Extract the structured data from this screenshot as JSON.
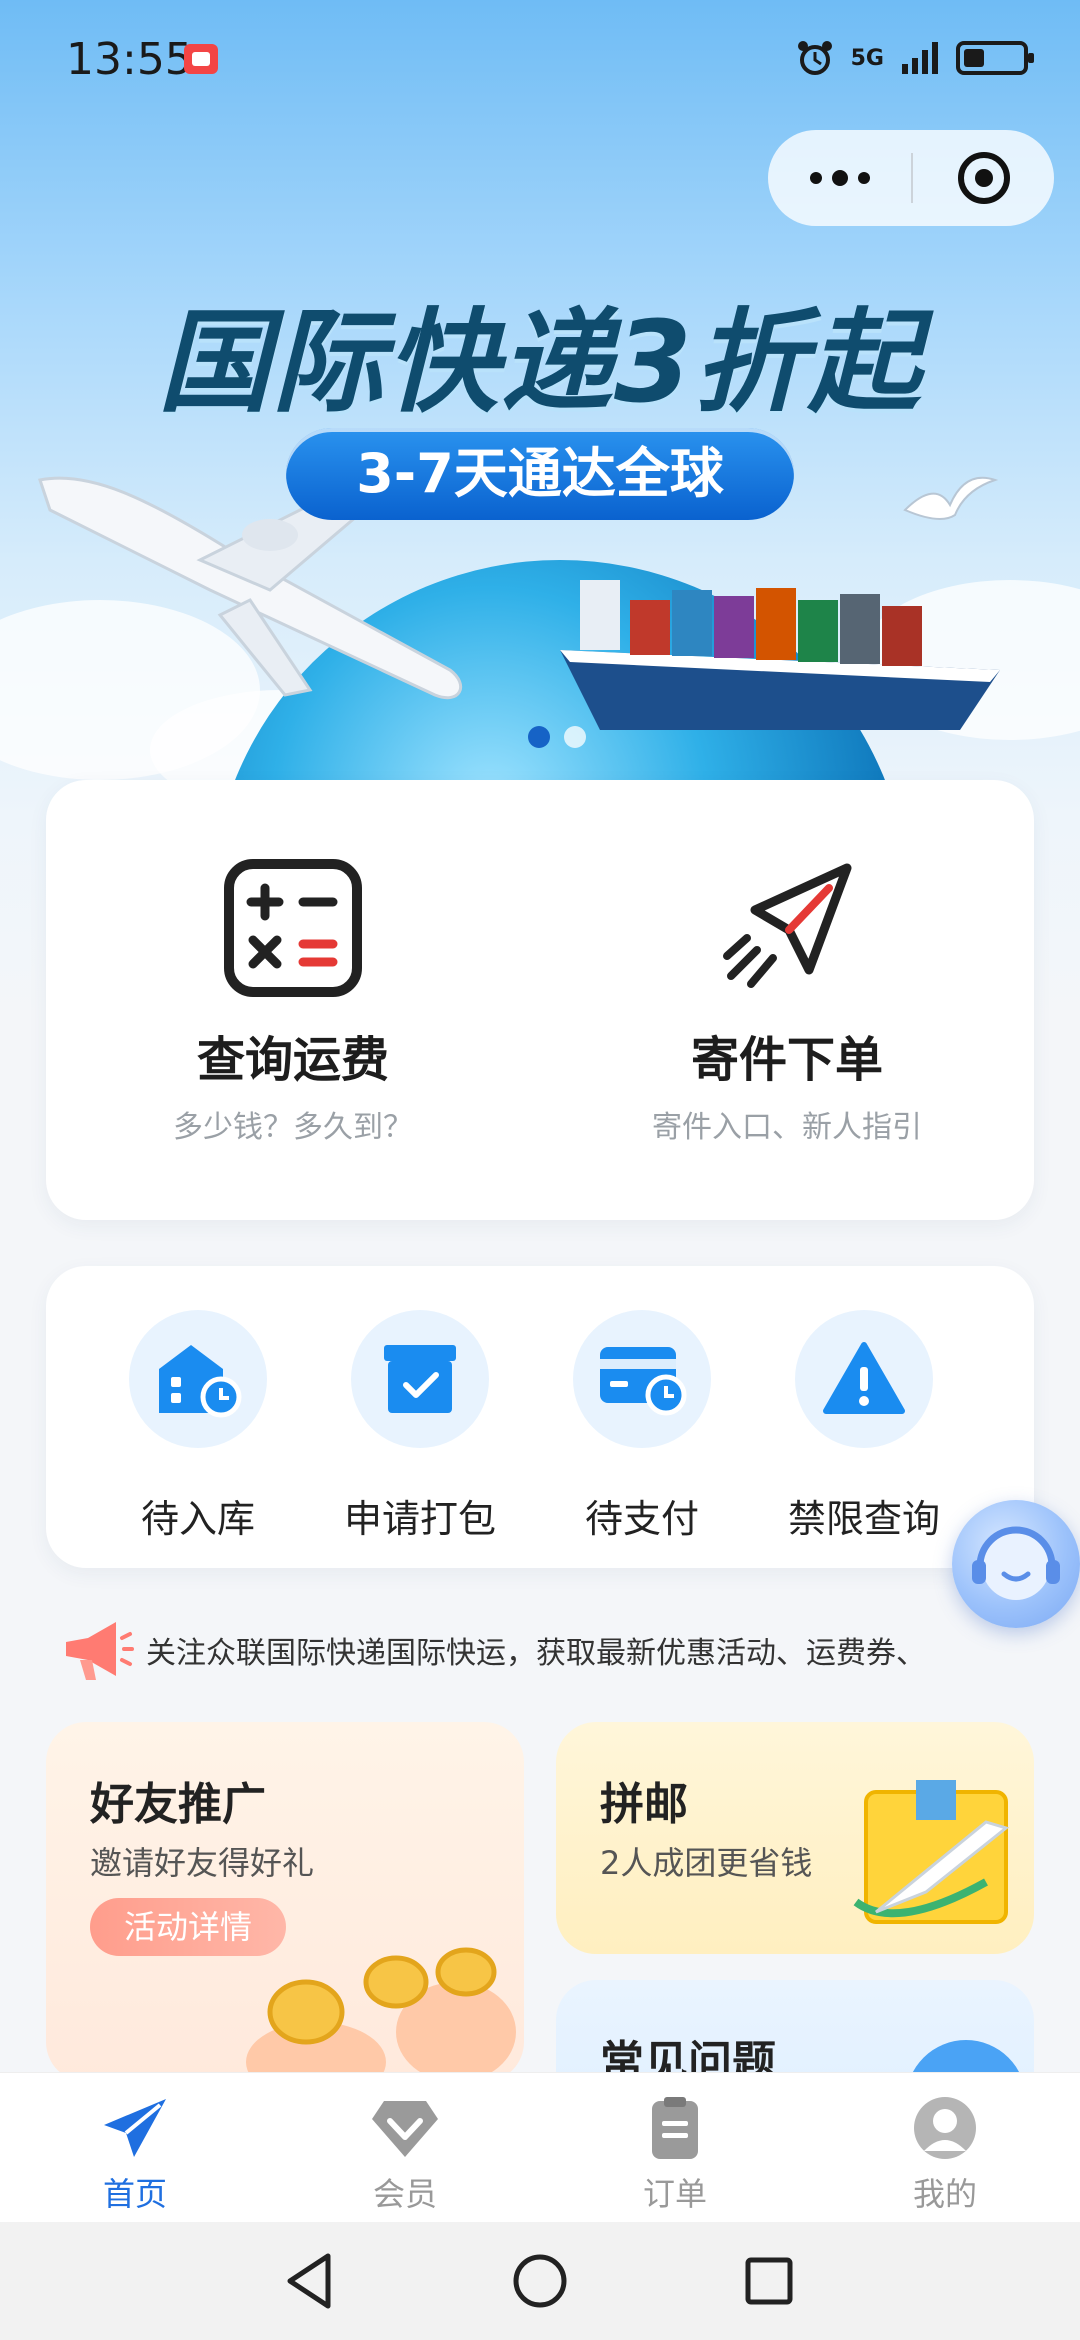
{
  "status_bar": {
    "time": "13:55",
    "network": "5G"
  },
  "capsule": {
    "more_icon": "more-dots-icon",
    "close_icon": "target-close-icon"
  },
  "banner": {
    "headline": "国际快递3折起",
    "subtitle": "3-7天通达全球",
    "slides": 2,
    "active_slide": 1
  },
  "main_actions": [
    {
      "title": "查询运费",
      "subtitle": "多少钱？多久到？",
      "icon": "calculator-icon"
    },
    {
      "title": "寄件下单",
      "subtitle": "寄件入口、新人指引",
      "icon": "paper-plane-icon"
    }
  ],
  "quick_actions": [
    {
      "label": "待入库",
      "icon": "warehouse-clock-icon"
    },
    {
      "label": "申请打包",
      "icon": "package-check-icon"
    },
    {
      "label": "待支付",
      "icon": "card-clock-icon"
    },
    {
      "label": "禁限查询",
      "icon": "warning-icon"
    }
  ],
  "notice": {
    "icon": "megaphone-icon",
    "text": "关注众联国际快递国际快运，获取最新优惠活动、运费券、"
  },
  "promos": {
    "friend": {
      "title": "好友推广",
      "subtitle": "邀请好友得好礼",
      "button": "活动详情"
    },
    "pinyou": {
      "title": "拼邮",
      "subtitle": "2人成团更省钱"
    },
    "faq": {
      "title": "常见问题"
    }
  },
  "tabbar": [
    {
      "label": "首页",
      "icon": "paper-plane-tab-icon",
      "active": true
    },
    {
      "label": "会员",
      "icon": "member-diamond-icon",
      "active": false
    },
    {
      "label": "订单",
      "icon": "order-clipboard-icon",
      "active": false
    },
    {
      "label": "我的",
      "icon": "profile-icon",
      "active": false
    }
  ],
  "colors": {
    "accent": "#1f6fe0",
    "quick_icon": "#1a8cf0",
    "notice_icon": "#ff6b6b"
  }
}
